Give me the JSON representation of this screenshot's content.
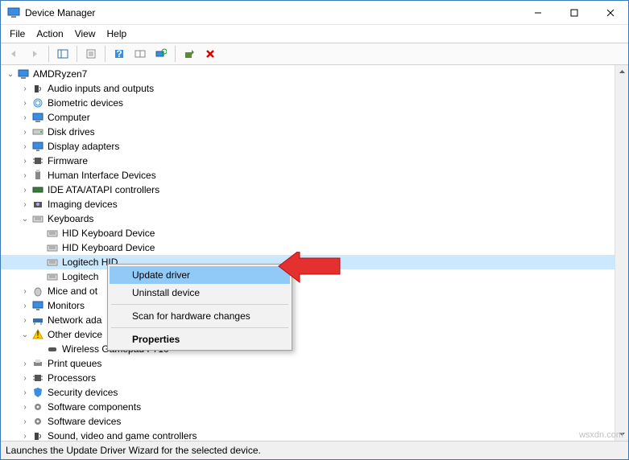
{
  "titlebar": {
    "title": "Device Manager"
  },
  "menu": {
    "file": "File",
    "action": "Action",
    "view": "View",
    "help": "Help"
  },
  "tree": {
    "root": "AMDRyzen7",
    "items": [
      "Audio inputs and outputs",
      "Biometric devices",
      "Computer",
      "Disk drives",
      "Display adapters",
      "Firmware",
      "Human Interface Devices",
      "IDE ATA/ATAPI controllers",
      "Imaging devices"
    ],
    "keyboards_label": "Keyboards",
    "keyboards_children": [
      "HID Keyboard Device",
      "HID Keyboard Device",
      "Logitech HID",
      "Logitech"
    ],
    "after_keyboards": [
      "Mice and ot",
      "Monitors",
      "Network ada"
    ],
    "other_devices_label": "Other device",
    "other_devices_child": "Wireless Gamepad F710",
    "after_other": [
      "Print queues",
      "Processors",
      "Security devices",
      "Software components",
      "Software devices",
      "Sound, video and game controllers"
    ]
  },
  "context": {
    "update": "Update driver",
    "uninstall": "Uninstall device",
    "scan": "Scan for hardware changes",
    "properties": "Properties"
  },
  "statusbar": {
    "text": "Launches the Update Driver Wizard for the selected device."
  },
  "watermark": "wsxdn.com",
  "icons": {
    "app": "computer-tree",
    "categories": {
      "audio": "speaker",
      "biometric": "fingerprint",
      "computer": "monitor",
      "disk": "drive",
      "display": "monitor",
      "firmware": "chip",
      "hid": "usb",
      "ide": "card",
      "imaging": "camera",
      "keyboard": "keyboard",
      "mouse": "mouse",
      "monitor": "monitor",
      "network": "network",
      "other": "warning",
      "gamepad": "gamepad",
      "printer": "printer",
      "cpu": "chip",
      "security": "shield",
      "software": "gear",
      "sound": "speaker"
    }
  }
}
